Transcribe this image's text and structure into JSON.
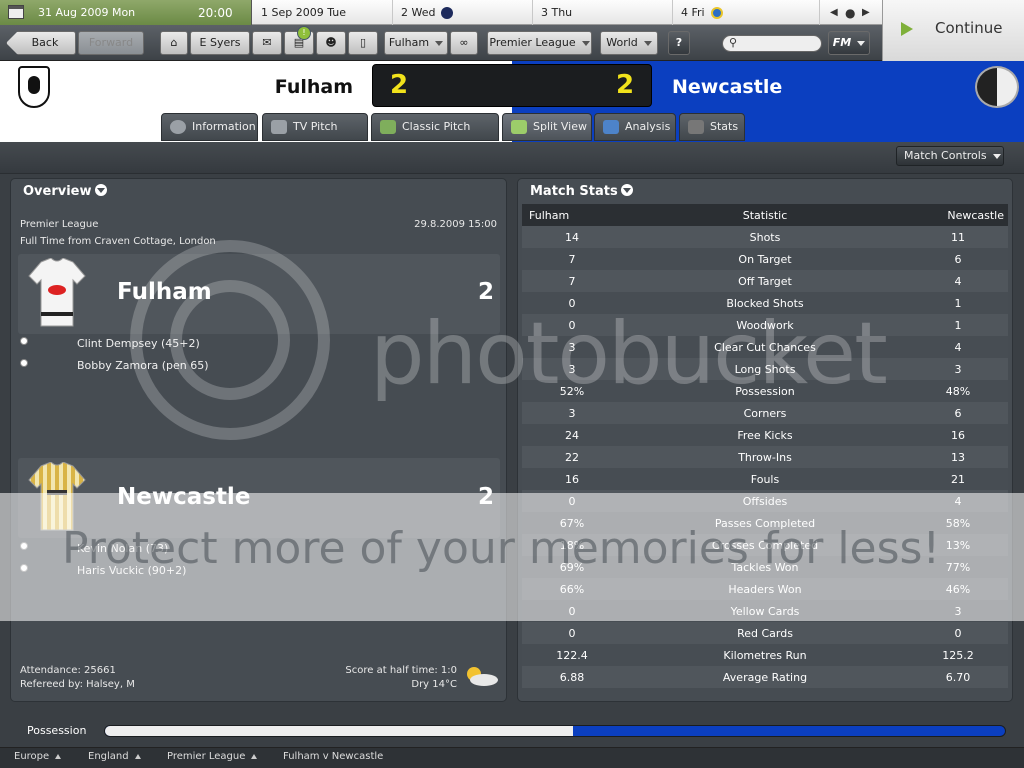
{
  "datebar": {
    "current_date": "31 Aug 2009  Mon",
    "current_time": "20:00",
    "days": [
      "1 Sep 2009  Tue",
      "2  Wed",
      "3  Thu",
      "4  Fri"
    ]
  },
  "toolbar": {
    "back": "Back",
    "forward": "Forward",
    "manager": "E Syers",
    "club": "Fulham",
    "competition": "Premier League",
    "world": "World",
    "help": "?",
    "fm_menu": "FM",
    "continue": "Continue"
  },
  "match": {
    "home_team": "Fulham",
    "away_team": "Newcastle",
    "home_score": "2",
    "away_score": "2"
  },
  "tabs": [
    "Information",
    "TV Pitch View",
    "Classic Pitch View",
    "Split View",
    "Analysis",
    "Stats"
  ],
  "match_controls": "Match Controls",
  "overview": {
    "title": "Overview",
    "competition": "Premier League",
    "datetime": "29.8.2009 15:00",
    "venue": "Full Time from Craven Cottage, London",
    "home": {
      "name": "Fulham",
      "score": "2",
      "scorers": [
        "Clint Dempsey (45+2)",
        "Bobby Zamora (pen 65)"
      ]
    },
    "away": {
      "name": "Newcastle",
      "score": "2",
      "scorers": [
        "Kevin Nolan (73)",
        "Haris Vuckic (90+2)"
      ]
    },
    "attendance": "Attendance: 25661",
    "referee": "Refereed by: Halsey, M",
    "half_time": "Score at half time: 1:0",
    "weather": "Dry 14°C"
  },
  "match_stats": {
    "title": "Match Stats",
    "columns": [
      "Fulham",
      "Statistic",
      "Newcastle"
    ],
    "rows": [
      [
        "14",
        "Shots",
        "11"
      ],
      [
        "7",
        "On Target",
        "6"
      ],
      [
        "7",
        "Off Target",
        "4"
      ],
      [
        "0",
        "Blocked Shots",
        "1"
      ],
      [
        "0",
        "Woodwork",
        "1"
      ],
      [
        "3",
        "Clear Cut Chances",
        "4"
      ],
      [
        "3",
        "Long Shots",
        "3"
      ],
      [
        "52%",
        "Possession",
        "48%"
      ],
      [
        "3",
        "Corners",
        "6"
      ],
      [
        "24",
        "Free Kicks",
        "16"
      ],
      [
        "22",
        "Throw-Ins",
        "13"
      ],
      [
        "16",
        "Fouls",
        "21"
      ],
      [
        "0",
        "Offsides",
        "4"
      ],
      [
        "67%",
        "Passes Completed",
        "58%"
      ],
      [
        "18%",
        "Crosses Completed",
        "13%"
      ],
      [
        "69%",
        "Tackles Won",
        "77%"
      ],
      [
        "66%",
        "Headers Won",
        "46%"
      ],
      [
        "0",
        "Yellow Cards",
        "3"
      ],
      [
        "0",
        "Red Cards",
        "0"
      ],
      [
        "122.4",
        "Kilometres Run",
        "125.2"
      ],
      [
        "6.88",
        "Average Rating",
        "6.70"
      ]
    ]
  },
  "possession": {
    "label": "Possession",
    "home_fraction": 0.52
  },
  "breadcrumbs": [
    "Europe",
    "England",
    "Premier League",
    "Fulham v Newcastle"
  ],
  "watermark": {
    "brand": "photobucket",
    "slogan": "Protect more of your memories for less!"
  },
  "colors": {
    "away_blue": "#0b3fc0",
    "score_yellow": "#f1e21b"
  }
}
